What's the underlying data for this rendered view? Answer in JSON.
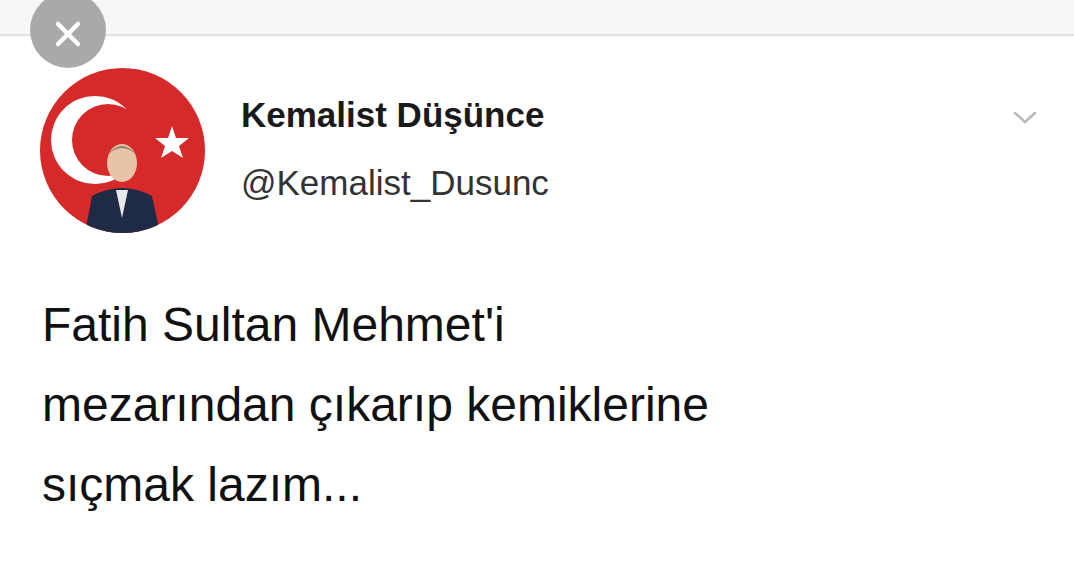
{
  "account": {
    "name": "Kemalist Düşünce",
    "handle": "@Kemalist_Dusunc"
  },
  "tweet": {
    "lines": [
      "Fatih Sultan Mehmet'i",
      "mezarından çıkarıp kemiklerine",
      "sıçmak lazım..."
    ]
  }
}
